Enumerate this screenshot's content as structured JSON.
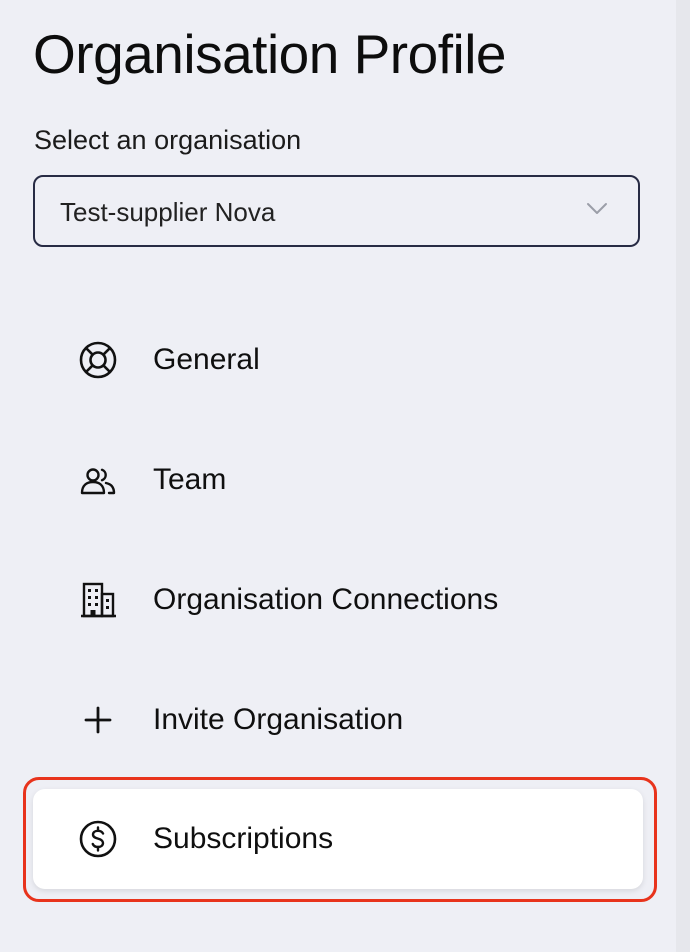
{
  "page": {
    "title": "Organisation Profile"
  },
  "organisation_select": {
    "label": "Select an organisation",
    "value": "Test-supplier Nova"
  },
  "nav": {
    "items": [
      {
        "label": "General",
        "icon": "lifebuoy-icon"
      },
      {
        "label": "Team",
        "icon": "users-icon"
      },
      {
        "label": "Organisation Connections",
        "icon": "building-icon"
      },
      {
        "label": "Invite Organisation",
        "icon": "plus-icon"
      },
      {
        "label": "Subscriptions",
        "icon": "dollar-circle-icon",
        "active": true
      }
    ]
  },
  "colors": {
    "background": "#eeeff5",
    "select_border": "#272b44",
    "active_item_bg": "#ffffff",
    "highlight_ring": "#e8331c"
  }
}
